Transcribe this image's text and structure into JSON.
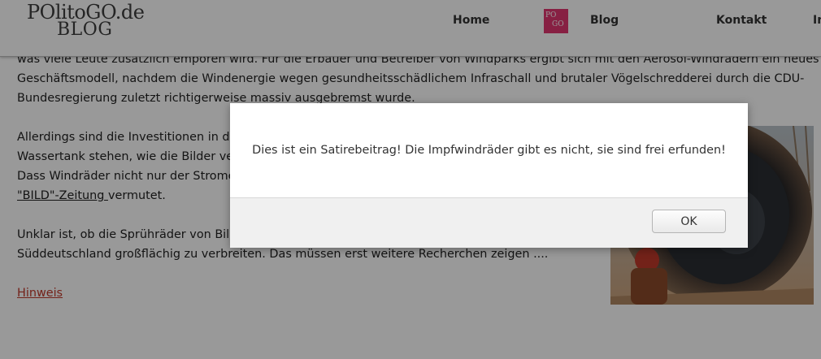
{
  "site": {
    "logo_line1": "POlitoGO.de",
    "logo_line2": "BLOG",
    "mini_logo_line1": "PO",
    "mini_logo_line2": "GO"
  },
  "nav": {
    "home": "Home",
    "blog": "Blog",
    "kontakt": "Kontakt",
    "more": "In"
  },
  "article": {
    "para1": [
      "was viele Leute zusätzlich empören wird. Für die Erbauer und Betreiber von Windparks ergibt sich mit den Aerosol-Windrädern ein neues",
      "Geschäftsmodell, nachdem die Windenergie wegen gesundheitsschädlichem Infraschall und brutaler Vögelschredderei durch die CDU-",
      "Bundesregierung zuletzt richtigerweise massiv ausgebremst wurde."
    ],
    "para2": [
      "Allerdings sind die Investitionen in die",
      "Wassertank stehen, wie die Bilder verd",
      "Dass Windräder nicht nur der Stromerz"
    ],
    "bild_link": "\"BILD\"-Zeitung ",
    "bild_suffix": "vermutet.",
    "para3": [
      "Unklar ist, ob die Sprühräder von Bill G",
      "Süddeutschland großflächig zu verbreiten. Das müssen erst weitere Recherchen zeigen ...."
    ],
    "hinweis": "Hinweis"
  },
  "dialog": {
    "message": "Dies ist ein Satirebeitrag! Die Impfwindräder gibt es nicht, sie sind frei erfunden!",
    "ok_label": "OK"
  },
  "colors": {
    "accent": "#e23670",
    "link": "#c0392b"
  }
}
